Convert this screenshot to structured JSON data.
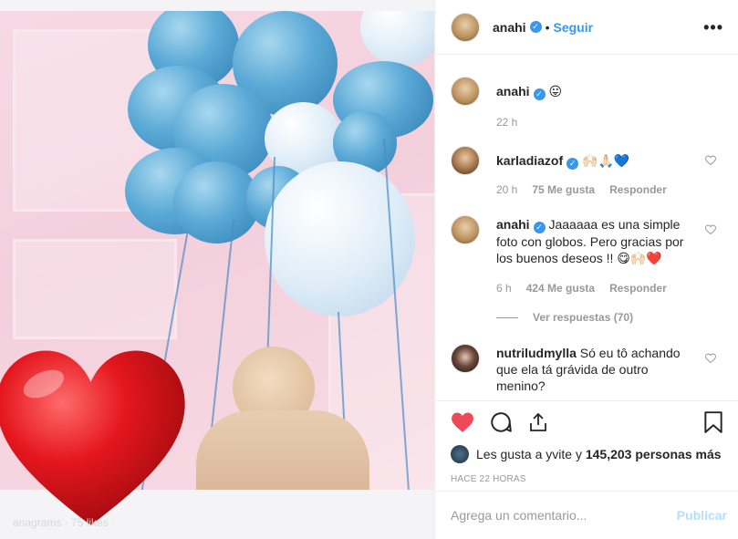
{
  "post": {
    "username": "anahi",
    "follow_label": "Seguir",
    "separator": "•",
    "more_label": "•••",
    "caption_emoji": "😛",
    "caption_time": "22 h",
    "photo_overlay_text": "anagrams · 75 likes ·"
  },
  "comments": [
    {
      "username": "karladiazof",
      "verified": true,
      "text": "🙌🏻🙏🏻💙",
      "time": "20 h",
      "likes": "75 Me gusta",
      "reply_label": "Responder"
    },
    {
      "username": "anahi",
      "verified": true,
      "text": "Jaaaaaa es una simple foto con globos. Pero gracias por los buenos deseos !! 😋🙌🏻❤️",
      "time": "6 h",
      "likes": "424 Me gusta",
      "reply_label": "Responder",
      "view_replies": "Ver respuestas (70)"
    },
    {
      "username": "nutriludmylla",
      "verified": false,
      "text": "Só eu tô achando que ela tá grávida de outro menino?"
    }
  ],
  "likes": {
    "prefix": "Les gusta a",
    "user": "yvite",
    "middle": "y",
    "count": "145,203 personas más"
  },
  "timestamp": "HACE 22 HORAS",
  "add_comment": {
    "placeholder": "Agrega un comentario...",
    "publish_label": "Publicar"
  },
  "colors": {
    "accent": "#3897f0",
    "like_red": "#ed4956",
    "muted": "#999999",
    "publish_disabled": "#b2dffc"
  },
  "icons": [
    "verified-badge-icon",
    "more-options-icon",
    "heart-outline-icon",
    "heart-filled-icon",
    "comment-icon",
    "share-icon",
    "bookmark-icon"
  ]
}
